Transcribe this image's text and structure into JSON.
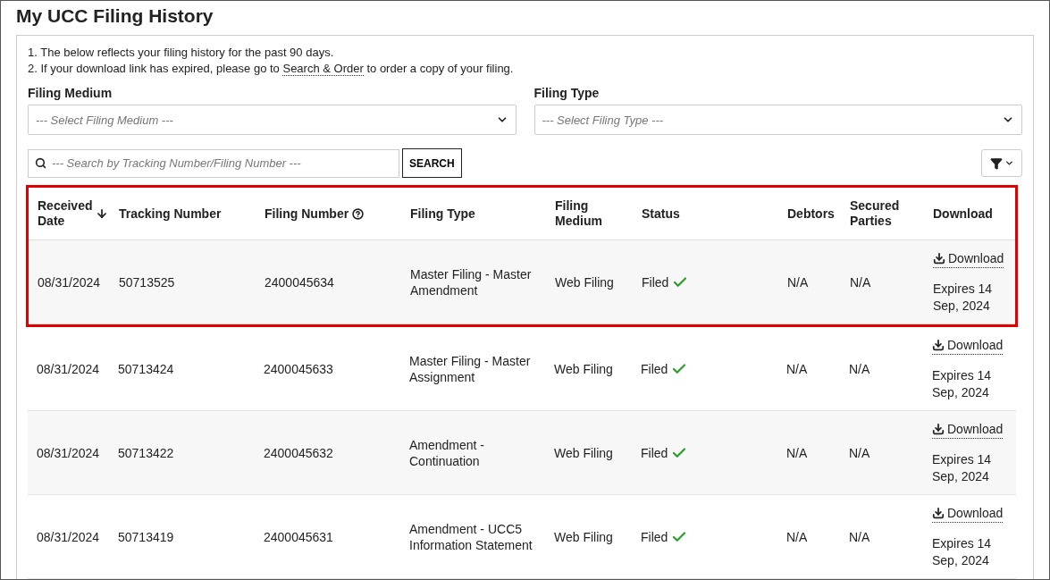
{
  "title": "My UCC Filing History",
  "notes": [
    {
      "text": "1. The below reflects your filing history for the past 90 days."
    },
    {
      "text": "2. If your download link has expired, please go to",
      "link": "Search & Order",
      "after": "to order a copy of your filing."
    }
  ],
  "filters": [
    {
      "label": "Filing Medium",
      "placeholder": "--- Select Filing Medium ---"
    },
    {
      "label": "Filing Type",
      "placeholder": "--- Select Filing Type ---"
    }
  ],
  "search": {
    "placeholder": "--- Search by Tracking Number/Filing Number ---",
    "button": "SEARCH"
  },
  "table": {
    "header_highlighted": true,
    "columns": [
      {
        "label": "Received Date",
        "kind": "sort"
      },
      {
        "label": "Tracking Number",
        "kind": "plain"
      },
      {
        "label": "Filing Number",
        "kind": "help"
      },
      {
        "label": "Filing Type",
        "kind": "plain"
      },
      {
        "label": "Filing Medium",
        "kind": "plain"
      },
      {
        "label": "Status",
        "kind": "plain"
      },
      {
        "label": "Debtors",
        "kind": "plain"
      },
      {
        "label": "Secured Parties",
        "kind": "plain"
      },
      {
        "label": "Download",
        "kind": "plain"
      }
    ],
    "rows": [
      {
        "highlighted": true,
        "received": "08/31/2024",
        "tracking": "50713525",
        "filing_number": "2400045634",
        "filing_type": "Master Filing - Master Amendment",
        "medium": "Web Filing",
        "status": "Filed",
        "debtors": "N/A",
        "secured": "N/A",
        "download": "Download",
        "expires": "Expires 14 Sep, 2024"
      },
      {
        "highlighted": false,
        "received": "08/31/2024",
        "tracking": "50713424",
        "filing_number": "2400045633",
        "filing_type": "Master Filing - Master Assignment",
        "medium": "Web Filing",
        "status": "Filed",
        "debtors": "N/A",
        "secured": "N/A",
        "download": "Download",
        "expires": "Expires 14 Sep, 2024"
      },
      {
        "highlighted": false,
        "received": "08/31/2024",
        "tracking": "50713422",
        "filing_number": "2400045632",
        "filing_type": "Amendment - Continuation",
        "medium": "Web Filing",
        "status": "Filed",
        "debtors": "N/A",
        "secured": "N/A",
        "download": "Download",
        "expires": "Expires 14 Sep, 2024"
      },
      {
        "highlighted": false,
        "received": "08/31/2024",
        "tracking": "50713419",
        "filing_number": "2400045631",
        "filing_type": "Amendment - UCC5 Information Statement",
        "medium": "Web Filing",
        "status": "Filed",
        "debtors": "N/A",
        "secured": "N/A",
        "download": "Download",
        "expires": "Expires 14 Sep, 2024"
      }
    ]
  }
}
